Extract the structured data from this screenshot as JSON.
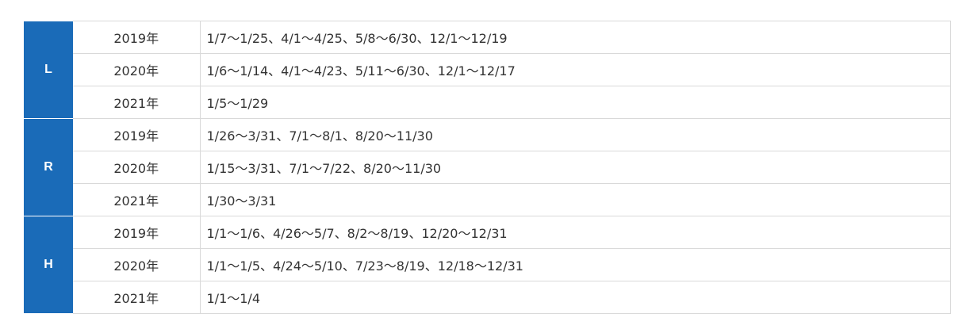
{
  "groups": [
    {
      "label": "L",
      "rows": [
        {
          "year": "2019年",
          "periods": "1/7～1/25、4/1～4/25、5/8～6/30、12/1～12/19"
        },
        {
          "year": "2020年",
          "periods": "1/6～1/14、4/1～4/23、5/11～6/30、12/1～12/17"
        },
        {
          "year": "2021年",
          "periods": "1/5～1/29"
        }
      ]
    },
    {
      "label": "R",
      "rows": [
        {
          "year": "2019年",
          "periods": "1/26～3/31、7/1～8/1、8/20～11/30"
        },
        {
          "year": "2020年",
          "periods": "1/15～3/31、7/1～7/22、8/20～11/30"
        },
        {
          "year": "2021年",
          "periods": "1/30～3/31"
        }
      ]
    },
    {
      "label": "H",
      "rows": [
        {
          "year": "2019年",
          "periods": "1/1～1/6、4/26～5/7、8/2～8/19、12/20～12/31"
        },
        {
          "year": "2020年",
          "periods": "1/1～1/5、4/24～5/10、7/23～8/19、12/18～12/31"
        },
        {
          "year": "2021年",
          "periods": "1/1～1/4"
        }
      ]
    }
  ],
  "colors": {
    "group_bg": "#1a6bb8",
    "border": "#d9d9d9"
  }
}
